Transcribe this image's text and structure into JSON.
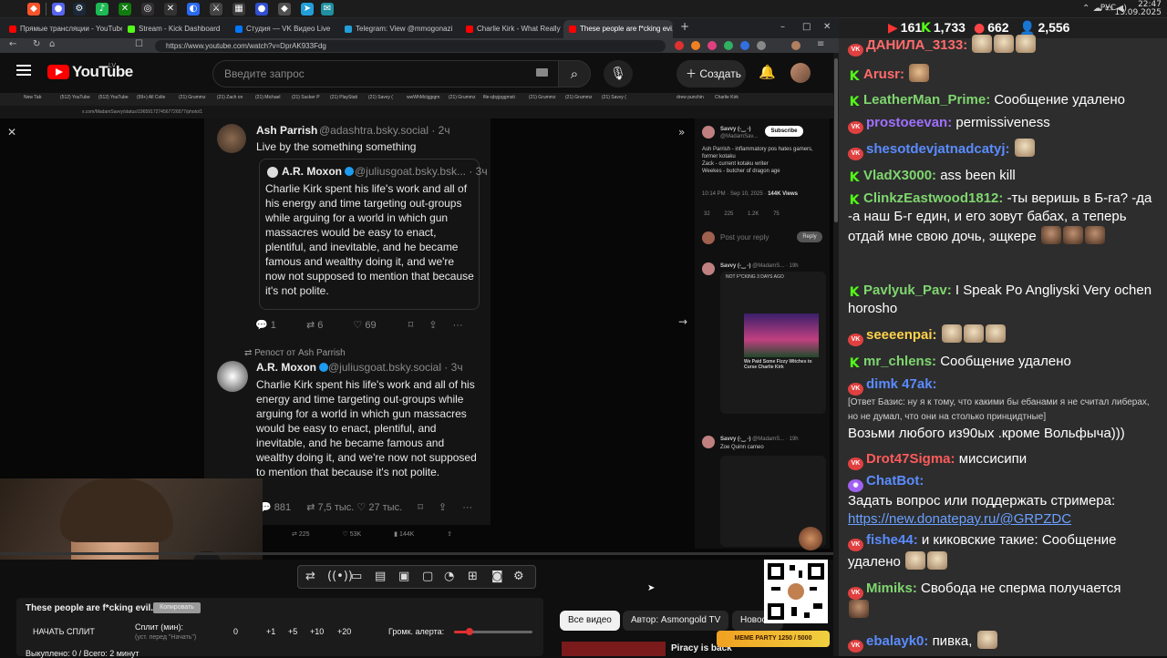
{
  "taskbar": {
    "time": "22:47",
    "date": "13.09.2025",
    "lang": "РУС"
  },
  "browser": {
    "tabs": [
      "Прямые трансляции - YouTube Stu...",
      "Stream - Kick Dashboard",
      "Студия — VK Видео Live",
      "Telegram: View @mmogonazi",
      "Charlie Kirk - What Really Happened...",
      "These people are f*cking evi..."
    ],
    "url": "https://www.youtube.com/watch?v=DprAK933Fdg"
  },
  "youtube": {
    "logo": "YouTube",
    "region": "LV",
    "search_placeholder": "Введите запрос",
    "create_label": "Создать"
  },
  "video": {
    "inner_tabs": [
      "New Tab",
      "(512) YouTube",
      "(512) YouTube",
      "(99+) All Colle",
      "(21) Grummz",
      "(21) Zach on",
      "(21) Michael",
      "(21) Sucker P",
      "(21) PlayStati",
      "(21) Savvy (",
      "wwWhMctgjpgm",
      "(21) Grummz",
      "file-qbyjpggmsti",
      "(21) Grummz",
      "(21) Grummz",
      "(21) Savvy (",
      "drew punchin",
      "Charlie Kirk"
    ],
    "inner_url": "x.com/MadamSavvy/status/1965917274567726577/photo/1",
    "post1": {
      "name": "Ash Parrish",
      "handle": "@adashtra.bsky.social · 2ч",
      "text": "Live by the something something"
    },
    "quote": {
      "name": "A.R. Moxon",
      "handle": "@juliusgoat.bsky.bsk... · 3ч",
      "text": "Charlie Kirk spent his life's work and all of his energy and time targeting out-groups while arguing for a world in which gun massacres would be easy to enact, plentiful, and inevitable, and he became famous and wealthy doing it, and we're now not supposed to mention that because it's not polite."
    },
    "post1_actions": {
      "replies": "1",
      "reposts": "6",
      "likes": "69"
    },
    "repost_label": "Репост от Ash Parrish",
    "post2": {
      "name": "A.R. Moxon",
      "handle": "@juliusgoat.bsky.social · 3ч",
      "text": "Charlie Kirk spent his life's work and all of his energy and time targeting out-groups while arguing for a world in which gun massacres would be easy to enact, plentiful, and inevitable, and he became famous and wealthy doing it, and we're now not supposed to mention that because it's not polite."
    },
    "post2_actions": {
      "replies": "881",
      "reposts": "7,5 тыс.",
      "likes": "27 тыс."
    },
    "x_actions": {
      "reposts": "225",
      "likes": "53K",
      "views": "144K"
    },
    "right": {
      "name": "Savvy (-‿ -)",
      "handle": "@MadamSav...",
      "subscribe": "Subscribe",
      "text": "Ash Parrish - inflammatory pos hates gamers, former kotaku\nZack - current kotaku writer\nWeekes - butcher of dragon age",
      "time": "10:14 PM · Sep 10, 2025 ·",
      "views": "144K Views",
      "stats": [
        "32",
        "225",
        "1.2K",
        "75"
      ],
      "reply_placeholder": "Post your reply",
      "reply_btn": "Reply",
      "reply1_name": "Savvy (-‿ -)",
      "reply1_handle": "@MadamS... · 19h",
      "reply1_caption": "NOT F*CKING 3 DAYS AGO",
      "card_headline": "We Paid Some Fizzy Witches to Curse Charlie Kirk",
      "reply2_name": "Savvy (-‿ -)",
      "reply2_handle": "@MadamS... · 19h",
      "reply2_text": "Zoe Quinn cameo"
    }
  },
  "controls": {
    "icons": [
      "repost-icon",
      "broadcast-icon",
      "tv-icon",
      "clapper-icon",
      "pip-icon",
      "gauge-icon",
      "add-icon",
      "camera-icon",
      "gear-icon"
    ]
  },
  "widget": {
    "title": "These people are f*cking evil..",
    "copy_label": "Копировать",
    "start_split": "НАЧАТЬ СПЛИТ",
    "split_label": "Сплит (мин):",
    "split_sub": "(уст. перед \"Начать\")",
    "split_value": "0",
    "steps": [
      "+1",
      "+5",
      "+10",
      "+20"
    ],
    "volume_label": "Громк. алерта:",
    "volume_fraction": 0.2,
    "bought": "Выкуплено: 0 / Всего: 2 минут"
  },
  "chips": [
    "Все видео",
    "Автор: Asmongold TV",
    "Новость"
  ],
  "related": {
    "title": "Piracy is back"
  },
  "meme_party": "MEME PARTY 1250 / 5000",
  "chat": {
    "stats": {
      "youtube": "161",
      "kick": "1,733",
      "vk": "662",
      "total": "2,556"
    },
    "messages": [
      {
        "badge": "vk",
        "user": "ДАНИЛА_3133:",
        "color": "#ff6b6b",
        "text": ""
      },
      {
        "badge": "kick",
        "user": "Arusr:",
        "color": "#ff6b6b",
        "text": ""
      },
      {
        "badge": "kick",
        "user": "LeatherMan_Prime:",
        "color": "#7fd66f",
        "text": "Сообщение удалено"
      },
      {
        "badge": "vk",
        "user": "prostoeevan:",
        "color": "#a070ff",
        "text": "permissiveness"
      },
      {
        "badge": "vk",
        "user": "shesotdevjatnadcatyj:",
        "color": "#5a8cff",
        "text": ""
      },
      {
        "badge": "kick",
        "user": "VladX3000:",
        "color": "#7fd66f",
        "text": "ass been kill"
      },
      {
        "badge": "kick",
        "user": "ClinkzEastwood1812:",
        "color": "#7fd66f",
        "text": "-ты веришь в Б-га? -да -а наш Б-г един, и его зовут бабах, а теперь отдай мне свою дочь, эщкере"
      },
      {
        "badge": "kick",
        "user": "Pavlyuk_Pav:",
        "color": "#7fd66f",
        "text": "I Speak Po Angliyski Very ochen horosho"
      },
      {
        "badge": "vk",
        "user": "seeeenpai:",
        "color": "#ffd24a",
        "text": ""
      },
      {
        "badge": "kick",
        "user": "mr_chlens:",
        "color": "#7fd66f",
        "text": "Сообщение удалено"
      },
      {
        "badge": "vk",
        "user": "dimk 47ak:",
        "color": "#5a8cff",
        "text": "[Ответ Базис: ну я к тому, что какими бы ебанами я не считал либерах, но не думал, что они на столько принцидтные]",
        "text2": "Возьми любого из90ых .кроме Вольфыча)))"
      },
      {
        "badge": "vk",
        "user": "Drot47Sigma:",
        "color": "#ff5a5a",
        "text": "миссисипи"
      },
      {
        "badge": "bot",
        "user": "ChatBot:",
        "color": "#5a8cff",
        "text": "Задать вопрос или поддержать стримера:",
        "link": "https://new.donatepay.ru/@GRPZDC"
      },
      {
        "badge": "vk",
        "user": "fishe44:",
        "color": "#5a8cff",
        "text": "и киковские такие: Сообщение удалено"
      },
      {
        "badge": "vk",
        "user": "Mimiks:",
        "color": "#7fd66f",
        "text": "Свобода не сперма получается"
      },
      {
        "badge": "vk",
        "user": "ebalayk0:",
        "color": "#5a8cff",
        "text": "пивка,"
      }
    ]
  }
}
